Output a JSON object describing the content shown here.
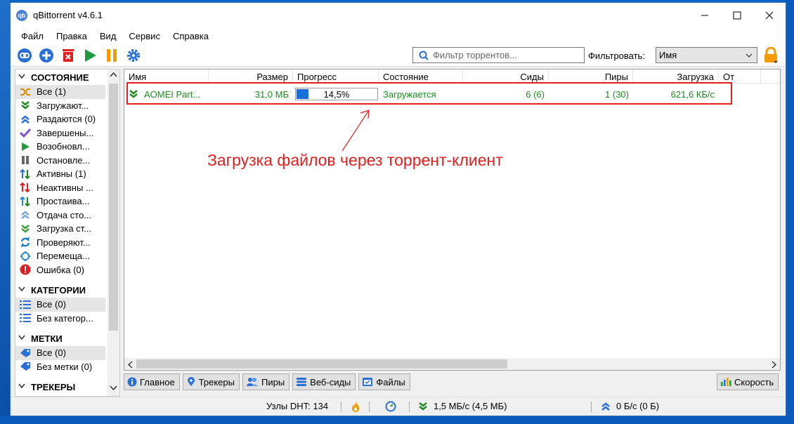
{
  "window": {
    "title": "qBittorrent v4.6.1",
    "app_icon_text": "qb"
  },
  "menu": [
    "Файл",
    "Правка",
    "Вид",
    "Сервис",
    "Справка"
  ],
  "toolbar": {
    "filter_placeholder": "Фильтр торрентов...",
    "filter_by_label": "Фильтровать:",
    "filter_by_value": "Имя"
  },
  "sidebar": {
    "status": {
      "title": "СОСТОЯНИЕ",
      "items": [
        {
          "label": "Все (1)",
          "icon": "all-icon",
          "color": "#e08a00"
        },
        {
          "label": "Загружают...",
          "icon": "download-icon",
          "color": "#1f8a1f"
        },
        {
          "label": "Раздаются (0)",
          "icon": "upload-icon",
          "color": "#2a6fd6"
        },
        {
          "label": "Завершены...",
          "icon": "check-icon",
          "color": "#7b4fd6"
        },
        {
          "label": "Возобновл...",
          "icon": "play-icon",
          "color": "#1f9a3f"
        },
        {
          "label": "Остановле...",
          "icon": "pause-icon",
          "color": "#666666"
        },
        {
          "label": "Активны (1)",
          "icon": "active-icon",
          "color": "#1f8a1f"
        },
        {
          "label": "Неактивны ...",
          "icon": "inactive-icon",
          "color": "#e02020"
        },
        {
          "label": "Простаива...",
          "icon": "stalled-icon",
          "color": "#2a8ad6"
        },
        {
          "label": "Отдача сто...",
          "icon": "stalled-upload-icon",
          "color": "#7aa8e0"
        },
        {
          "label": "Загрузка ст...",
          "icon": "stalled-download-icon",
          "color": "#3aa03a"
        },
        {
          "label": "Проверяют...",
          "icon": "checking-icon",
          "color": "#1a7ac0"
        },
        {
          "label": "Перемеща...",
          "icon": "moving-icon",
          "color": "#2a8ad6"
        },
        {
          "label": "Ошибка (0)",
          "icon": "error-icon",
          "color": "#e02020"
        }
      ]
    },
    "categories": {
      "title": "КАТЕГОРИИ",
      "items": [
        {
          "label": "Все (0)",
          "icon": "list-icon"
        },
        {
          "label": "Без категор...",
          "icon": "list-icon"
        }
      ]
    },
    "tags": {
      "title": "МЕТКИ",
      "items": [
        {
          "label": "Все (0)",
          "icon": "tag-icon"
        },
        {
          "label": "Без метки (0)",
          "icon": "tag-icon"
        }
      ]
    },
    "trackers": {
      "title": "ТРЕКЕРЫ"
    }
  },
  "table": {
    "headers": [
      "Имя",
      "Размер",
      "Прогресс",
      "Состояние",
      "Сиды",
      "Пиры",
      "Загрузка",
      "От"
    ],
    "rows": [
      {
        "name": "AOMEI Part...",
        "size": "31,0 МБ",
        "progress_text": "14,5%",
        "progress_fraction": 0.145,
        "status": "Загружается",
        "seeds": "6 (6)",
        "peers": "1 (30)",
        "dl_speed": "621,6 КБ/с"
      }
    ]
  },
  "annotation": {
    "text": "Загрузка файлов через торрент-клиент",
    "color": "#e02020"
  },
  "tabs": [
    "Главное",
    "Трекеры",
    "Пиры",
    "Веб-сиды",
    "Файлы"
  ],
  "speed_button": "Скорость",
  "status": {
    "dht": "Узлы DHT: 134",
    "download": "1,5 МБ/с (4,5 МБ)",
    "upload": "0 Б/с (0 Б)"
  }
}
